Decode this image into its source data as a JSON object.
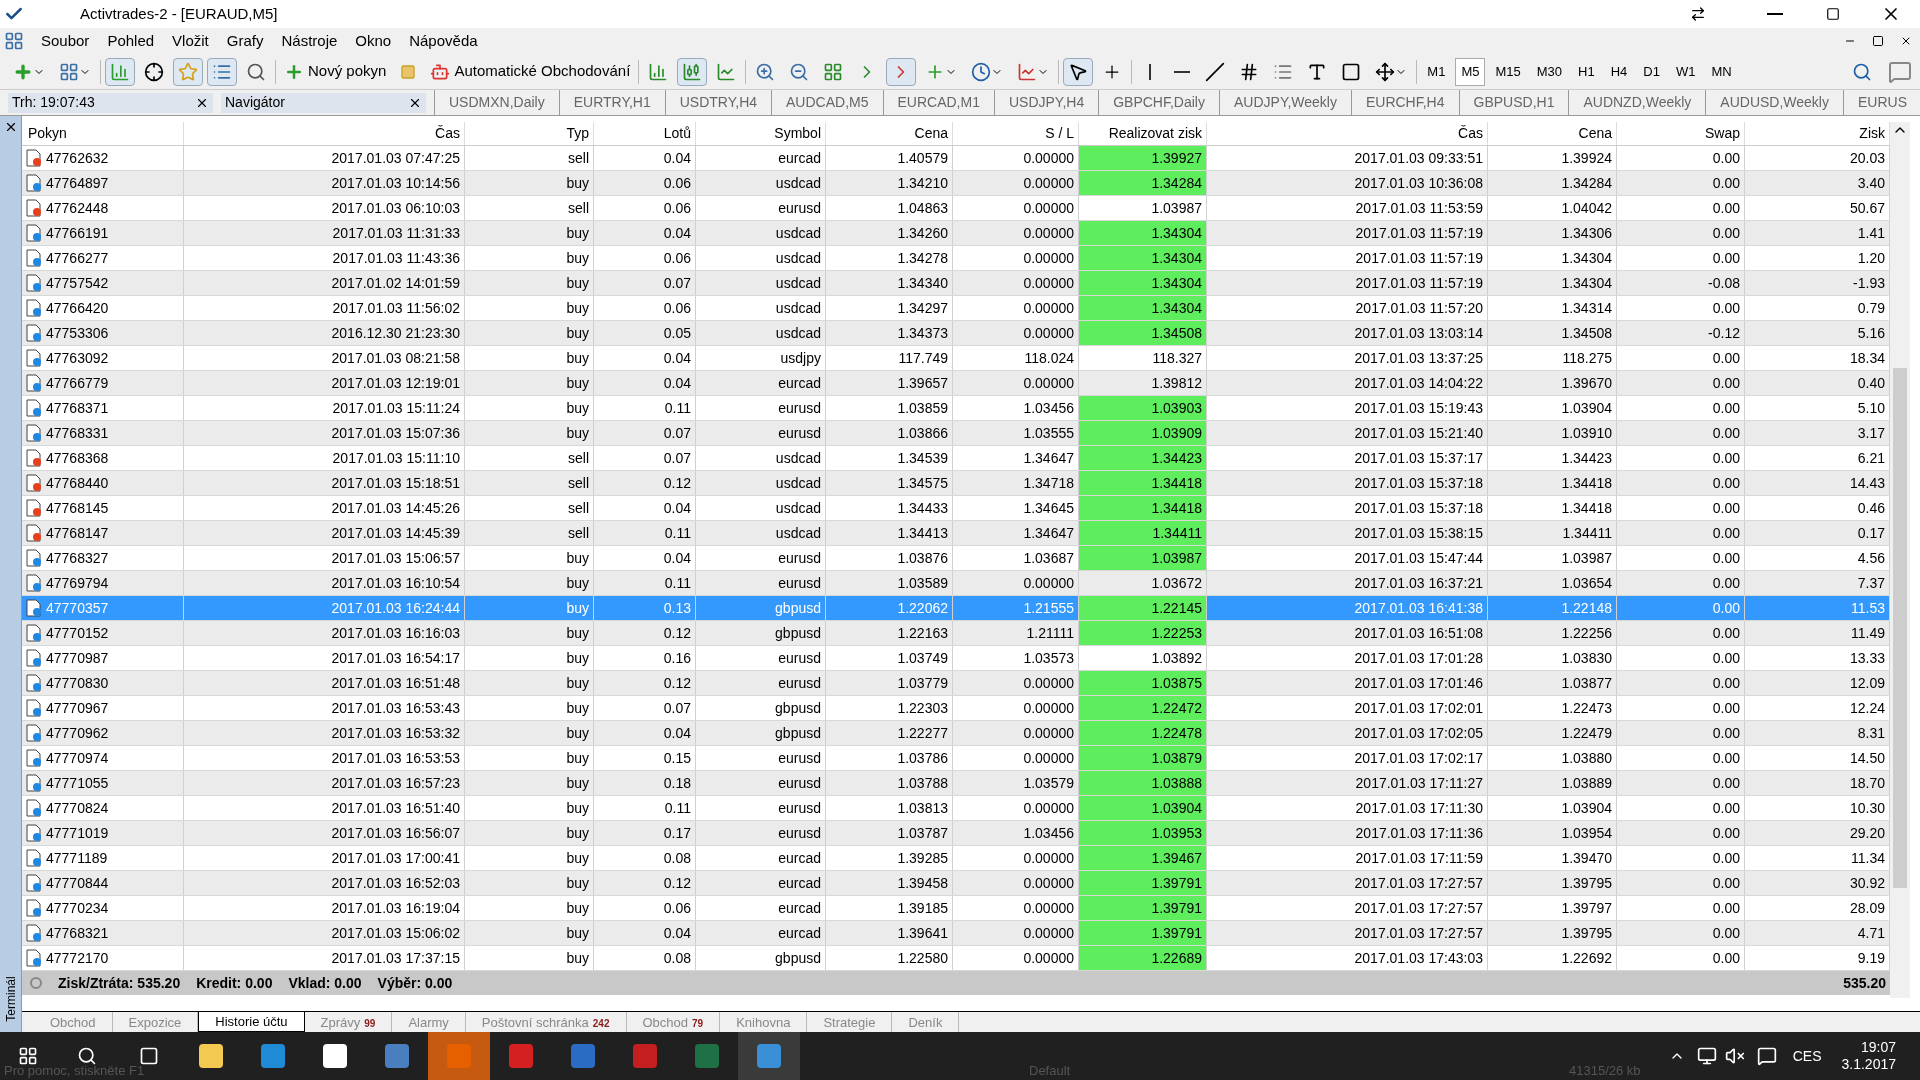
{
  "window": {
    "title": "Activtrades-2 - [EURAUD,M5]"
  },
  "menu": [
    "Soubor",
    "Pohled",
    "Vložit",
    "Grafy",
    "Nástroje",
    "Okno",
    "Nápověda"
  ],
  "toolbar": {
    "new_order": "Nový pokyn",
    "auto_trading": "Automatické Obchodování",
    "timeframes": [
      {
        "label": "M1",
        "selected": false
      },
      {
        "label": "M5",
        "selected": true
      },
      {
        "label": "M15",
        "selected": false
      },
      {
        "label": "M30",
        "selected": false
      },
      {
        "label": "H1",
        "selected": false
      },
      {
        "label": "H4",
        "selected": false
      },
      {
        "label": "D1",
        "selected": false
      },
      {
        "label": "W1",
        "selected": false
      },
      {
        "label": "MN",
        "selected": false
      }
    ]
  },
  "panels": [
    {
      "title": "Trh: 19:07:43"
    },
    {
      "title": "Navigátor"
    }
  ],
  "chart_tabs": [
    "USDMXN,Daily",
    "EURTRY,H1",
    "USDTRY,H4",
    "AUDCAD,M5",
    "EURCAD,M1",
    "USDJPY,H4",
    "GBPCHF,Daily",
    "AUDJPY,Weekly",
    "EURCHF,H4",
    "GBPUSD,H1",
    "AUDNZD,Weekly",
    "AUDUSD,Weekly",
    "EURUS"
  ],
  "table": {
    "columns": [
      "Pokyn",
      "Čas",
      "Typ",
      "Lotů",
      "Symbol",
      "Cena",
      "S / L",
      "Realizovat zisk",
      "Čas",
      "Cena",
      "Swap",
      "Zisk"
    ],
    "rows": [
      {
        "kind": "sell",
        "selected": false,
        "hit": true,
        "cells": [
          "47762632",
          "2017.01.03 07:47:25",
          "sell",
          "0.04",
          "eurcad",
          "1.40579",
          "0.00000",
          "1.39927",
          "2017.01.03 09:33:51",
          "1.39924",
          "0.00",
          "20.03"
        ]
      },
      {
        "kind": "buy",
        "selected": false,
        "hit": true,
        "cells": [
          "47764897",
          "2017.01.03 10:14:56",
          "buy",
          "0.06",
          "usdcad",
          "1.34210",
          "0.00000",
          "1.34284",
          "2017.01.03 10:36:08",
          "1.34284",
          "0.00",
          "3.40"
        ]
      },
      {
        "kind": "sell",
        "selected": false,
        "hit": false,
        "cells": [
          "47762448",
          "2017.01.03 06:10:03",
          "sell",
          "0.06",
          "eurusd",
          "1.04863",
          "0.00000",
          "1.03987",
          "2017.01.03 11:53:59",
          "1.04042",
          "0.00",
          "50.67"
        ]
      },
      {
        "kind": "buy",
        "selected": false,
        "hit": true,
        "cells": [
          "47766191",
          "2017.01.03 11:31:33",
          "buy",
          "0.04",
          "usdcad",
          "1.34260",
          "0.00000",
          "1.34304",
          "2017.01.03 11:57:19",
          "1.34306",
          "0.00",
          "1.41"
        ]
      },
      {
        "kind": "buy",
        "selected": false,
        "hit": true,
        "cells": [
          "47766277",
          "2017.01.03 11:43:36",
          "buy",
          "0.06",
          "usdcad",
          "1.34278",
          "0.00000",
          "1.34304",
          "2017.01.03 11:57:19",
          "1.34304",
          "0.00",
          "1.20"
        ]
      },
      {
        "kind": "buy",
        "selected": false,
        "hit": true,
        "cells": [
          "47757542",
          "2017.01.02 14:01:59",
          "buy",
          "0.07",
          "usdcad",
          "1.34340",
          "0.00000",
          "1.34304",
          "2017.01.03 11:57:19",
          "1.34304",
          "-0.08",
          "-1.93"
        ]
      },
      {
        "kind": "buy",
        "selected": false,
        "hit": true,
        "cells": [
          "47766420",
          "2017.01.03 11:56:02",
          "buy",
          "0.06",
          "usdcad",
          "1.34297",
          "0.00000",
          "1.34304",
          "2017.01.03 11:57:20",
          "1.34314",
          "0.00",
          "0.79"
        ]
      },
      {
        "kind": "buy",
        "selected": false,
        "hit": true,
        "cells": [
          "47753306",
          "2016.12.30 21:23:30",
          "buy",
          "0.05",
          "usdcad",
          "1.34373",
          "0.00000",
          "1.34508",
          "2017.01.03 13:03:14",
          "1.34508",
          "-0.12",
          "5.16"
        ]
      },
      {
        "kind": "buy",
        "selected": false,
        "hit": false,
        "cells": [
          "47763092",
          "2017.01.03 08:21:58",
          "buy",
          "0.04",
          "usdjpy",
          "117.749",
          "118.024",
          "118.327",
          "2017.01.03 13:37:25",
          "118.275",
          "0.00",
          "18.34"
        ]
      },
      {
        "kind": "buy",
        "selected": false,
        "hit": false,
        "cells": [
          "47766779",
          "2017.01.03 12:19:01",
          "buy",
          "0.04",
          "eurcad",
          "1.39657",
          "0.00000",
          "1.39812",
          "2017.01.03 14:04:22",
          "1.39670",
          "0.00",
          "0.40"
        ]
      },
      {
        "kind": "buy",
        "selected": false,
        "hit": true,
        "cells": [
          "47768371",
          "2017.01.03 15:11:24",
          "buy",
          "0.11",
          "eurusd",
          "1.03859",
          "1.03456",
          "1.03903",
          "2017.01.03 15:19:43",
          "1.03904",
          "0.00",
          "5.10"
        ]
      },
      {
        "kind": "buy",
        "selected": false,
        "hit": true,
        "cells": [
          "47768331",
          "2017.01.03 15:07:36",
          "buy",
          "0.07",
          "eurusd",
          "1.03866",
          "1.03555",
          "1.03909",
          "2017.01.03 15:21:40",
          "1.03910",
          "0.00",
          "3.17"
        ]
      },
      {
        "kind": "sell",
        "selected": false,
        "hit": true,
        "cells": [
          "47768368",
          "2017.01.03 15:11:10",
          "sell",
          "0.07",
          "usdcad",
          "1.34539",
          "1.34647",
          "1.34423",
          "2017.01.03 15:37:17",
          "1.34423",
          "0.00",
          "6.21"
        ]
      },
      {
        "kind": "sell",
        "selected": false,
        "hit": true,
        "cells": [
          "47768440",
          "2017.01.03 15:18:51",
          "sell",
          "0.12",
          "usdcad",
          "1.34575",
          "1.34718",
          "1.34418",
          "2017.01.03 15:37:18",
          "1.34418",
          "0.00",
          "14.43"
        ]
      },
      {
        "kind": "sell",
        "selected": false,
        "hit": true,
        "cells": [
          "47768145",
          "2017.01.03 14:45:26",
          "sell",
          "0.04",
          "usdcad",
          "1.34433",
          "1.34645",
          "1.34418",
          "2017.01.03 15:37:18",
          "1.34418",
          "0.00",
          "0.46"
        ]
      },
      {
        "kind": "sell",
        "selected": false,
        "hit": true,
        "cells": [
          "47768147",
          "2017.01.03 14:45:39",
          "sell",
          "0.11",
          "usdcad",
          "1.34413",
          "1.34647",
          "1.34411",
          "2017.01.03 15:38:15",
          "1.34411",
          "0.00",
          "0.17"
        ]
      },
      {
        "kind": "buy",
        "selected": false,
        "hit": true,
        "cells": [
          "47768327",
          "2017.01.03 15:06:57",
          "buy",
          "0.04",
          "eurusd",
          "1.03876",
          "1.03687",
          "1.03987",
          "2017.01.03 15:47:44",
          "1.03987",
          "0.00",
          "4.56"
        ]
      },
      {
        "kind": "buy",
        "selected": false,
        "hit": false,
        "cells": [
          "47769794",
          "2017.01.03 16:10:54",
          "buy",
          "0.11",
          "eurusd",
          "1.03589",
          "0.00000",
          "1.03672",
          "2017.01.03 16:37:21",
          "1.03654",
          "0.00",
          "7.37"
        ]
      },
      {
        "kind": "buy",
        "selected": true,
        "hit": true,
        "cells": [
          "47770357",
          "2017.01.03 16:24:44",
          "buy",
          "0.13",
          "gbpusd",
          "1.22062",
          "1.21555",
          "1.22145",
          "2017.01.03 16:41:38",
          "1.22148",
          "0.00",
          "11.53"
        ]
      },
      {
        "kind": "buy",
        "selected": false,
        "hit": true,
        "cells": [
          "47770152",
          "2017.01.03 16:16:03",
          "buy",
          "0.12",
          "gbpusd",
          "1.22163",
          "1.21111",
          "1.22253",
          "2017.01.03 16:51:08",
          "1.22256",
          "0.00",
          "11.49"
        ]
      },
      {
        "kind": "buy",
        "selected": false,
        "hit": false,
        "cells": [
          "47770987",
          "2017.01.03 16:54:17",
          "buy",
          "0.16",
          "eurusd",
          "1.03749",
          "1.03573",
          "1.03892",
          "2017.01.03 17:01:28",
          "1.03830",
          "0.00",
          "13.33"
        ]
      },
      {
        "kind": "buy",
        "selected": false,
        "hit": true,
        "cells": [
          "47770830",
          "2017.01.03 16:51:48",
          "buy",
          "0.12",
          "eurusd",
          "1.03779",
          "0.00000",
          "1.03875",
          "2017.01.03 17:01:46",
          "1.03877",
          "0.00",
          "12.09"
        ]
      },
      {
        "kind": "buy",
        "selected": false,
        "hit": true,
        "cells": [
          "47770967",
          "2017.01.03 16:53:43",
          "buy",
          "0.07",
          "gbpusd",
          "1.22303",
          "0.00000",
          "1.22472",
          "2017.01.03 17:02:01",
          "1.22473",
          "0.00",
          "12.24"
        ]
      },
      {
        "kind": "buy",
        "selected": false,
        "hit": true,
        "cells": [
          "47770962",
          "2017.01.03 16:53:32",
          "buy",
          "0.04",
          "gbpusd",
          "1.22277",
          "0.00000",
          "1.22478",
          "2017.01.03 17:02:05",
          "1.22479",
          "0.00",
          "8.31"
        ]
      },
      {
        "kind": "buy",
        "selected": false,
        "hit": true,
        "cells": [
          "47770974",
          "2017.01.03 16:53:53",
          "buy",
          "0.15",
          "eurusd",
          "1.03786",
          "0.00000",
          "1.03879",
          "2017.01.03 17:02:17",
          "1.03880",
          "0.00",
          "14.50"
        ]
      },
      {
        "kind": "buy",
        "selected": false,
        "hit": true,
        "cells": [
          "47771055",
          "2017.01.03 16:57:23",
          "buy",
          "0.18",
          "eurusd",
          "1.03788",
          "1.03579",
          "1.03888",
          "2017.01.03 17:11:27",
          "1.03889",
          "0.00",
          "18.70"
        ]
      },
      {
        "kind": "buy",
        "selected": false,
        "hit": true,
        "cells": [
          "47770824",
          "2017.01.03 16:51:40",
          "buy",
          "0.11",
          "eurusd",
          "1.03813",
          "0.00000",
          "1.03904",
          "2017.01.03 17:11:30",
          "1.03904",
          "0.00",
          "10.30"
        ]
      },
      {
        "kind": "buy",
        "selected": false,
        "hit": true,
        "cells": [
          "47771019",
          "2017.01.03 16:56:07",
          "buy",
          "0.17",
          "eurusd",
          "1.03787",
          "1.03456",
          "1.03953",
          "2017.01.03 17:11:36",
          "1.03954",
          "0.00",
          "29.20"
        ]
      },
      {
        "kind": "buy",
        "selected": false,
        "hit": true,
        "cells": [
          "47771189",
          "2017.01.03 17:00:41",
          "buy",
          "0.08",
          "eurcad",
          "1.39285",
          "0.00000",
          "1.39467",
          "2017.01.03 17:11:59",
          "1.39470",
          "0.00",
          "11.34"
        ]
      },
      {
        "kind": "buy",
        "selected": false,
        "hit": true,
        "cells": [
          "47770844",
          "2017.01.03 16:52:03",
          "buy",
          "0.12",
          "eurcad",
          "1.39458",
          "0.00000",
          "1.39791",
          "2017.01.03 17:27:57",
          "1.39795",
          "0.00",
          "30.92"
        ]
      },
      {
        "kind": "buy",
        "selected": false,
        "hit": true,
        "cells": [
          "47770234",
          "2017.01.03 16:19:04",
          "buy",
          "0.06",
          "eurcad",
          "1.39185",
          "0.00000",
          "1.39791",
          "2017.01.03 17:27:57",
          "1.39797",
          "0.00",
          "28.09"
        ]
      },
      {
        "kind": "buy",
        "selected": false,
        "hit": true,
        "cells": [
          "47768321",
          "2017.01.03 15:06:02",
          "buy",
          "0.04",
          "eurcad",
          "1.39641",
          "0.00000",
          "1.39791",
          "2017.01.03 17:27:57",
          "1.39795",
          "0.00",
          "4.71"
        ]
      },
      {
        "kind": "buy",
        "selected": false,
        "hit": true,
        "cells": [
          "47772170",
          "2017.01.03 17:37:15",
          "buy",
          "0.08",
          "gbpusd",
          "1.22580",
          "0.00000",
          "1.22689",
          "2017.01.03 17:43:03",
          "1.22692",
          "0.00",
          "9.19"
        ]
      }
    ],
    "summary": [
      "Zisk/Ztráta: 535.20",
      "Kredit: 0.00",
      "Vklad: 0.00",
      "Výběr: 0.00"
    ],
    "total": "535.20"
  },
  "terminal": {
    "label": "Terminál",
    "tabs": [
      {
        "label": "Obchod",
        "selected": false
      },
      {
        "label": "Expozice",
        "selected": false
      },
      {
        "label": "Historie účtu",
        "selected": true
      },
      {
        "label": "Zprávy",
        "badge": "99",
        "selected": false
      },
      {
        "label": "Alarmy",
        "selected": false
      },
      {
        "label": "Poštovní schránka",
        "badge": "242",
        "selected": false
      },
      {
        "label": "Obchod",
        "badge": "79",
        "selected": false
      },
      {
        "label": "Knihovna",
        "selected": false
      },
      {
        "label": "Strategie",
        "selected": false
      },
      {
        "label": "Deník",
        "selected": false
      }
    ]
  },
  "status_bar": [
    "Pro pomoc, stiskněte F1",
    "Default",
    "41315/26 kb"
  ],
  "taskbar": {
    "language": "CES",
    "time": "19:07",
    "date": "3.1.2017"
  }
}
